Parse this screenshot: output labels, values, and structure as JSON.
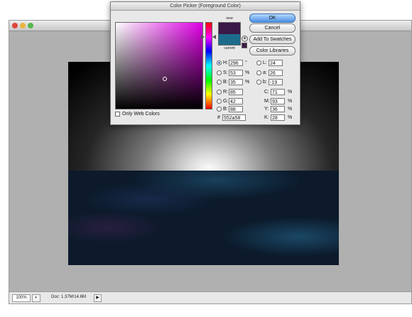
{
  "dialog": {
    "title": "Color Picker (Foreground Color)",
    "new_label": "new",
    "current_label": "current",
    "new_color": "#3b1947",
    "current_color": "#1c6b8c",
    "buttons": {
      "ok": "OK",
      "cancel": "Cancel",
      "add_to_swatches": "Add To Swatches",
      "color_libraries": "Color Libraries"
    },
    "only_web_colors": "Only Web Colors",
    "hsb": {
      "h": {
        "label": "H:",
        "value": "296",
        "unit": "°"
      },
      "s": {
        "label": "S:",
        "value": "53",
        "unit": "%"
      },
      "b": {
        "label": "B:",
        "value": "35",
        "unit": "%"
      }
    },
    "rgb": {
      "r": {
        "label": "R:",
        "value": "85"
      },
      "g": {
        "label": "G:",
        "value": "42"
      },
      "b": {
        "label": "B:",
        "value": "88"
      }
    },
    "lab": {
      "l": {
        "label": "L:",
        "value": "24"
      },
      "a": {
        "label": "a:",
        "value": "26"
      },
      "b": {
        "label": "b:",
        "value": "-19"
      }
    },
    "cmyk": {
      "c": {
        "label": "C:",
        "value": "71",
        "unit": "%"
      },
      "m": {
        "label": "M:",
        "value": "93",
        "unit": "%"
      },
      "y": {
        "label": "Y:",
        "value": "36",
        "unit": "%"
      },
      "k": {
        "label": "K:",
        "value": "28",
        "unit": "%"
      }
    },
    "hex": {
      "label": "#",
      "value": "552a58"
    },
    "selected_mode": "H"
  },
  "statusbar": {
    "zoom": "100%",
    "doc_info": "Doc: 1.37M/14.6M"
  }
}
